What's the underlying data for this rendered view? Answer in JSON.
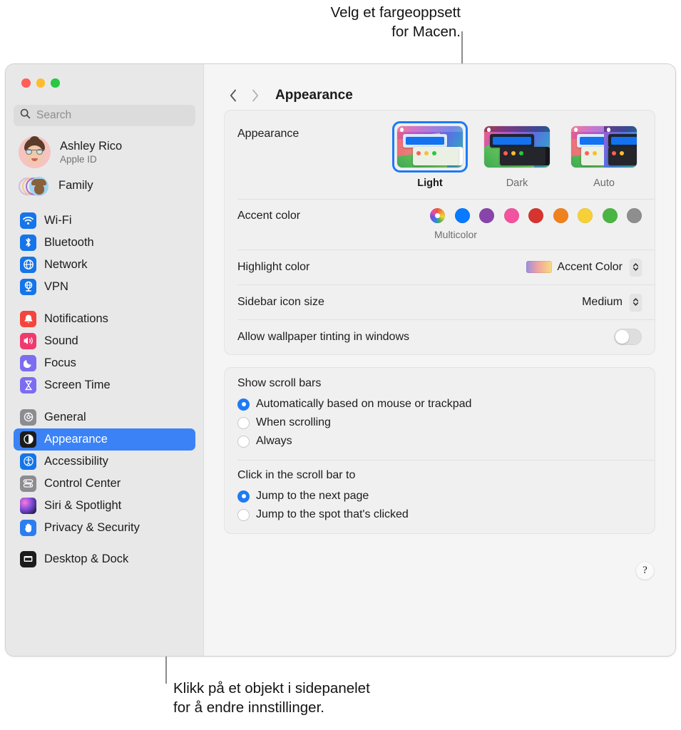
{
  "callouts": {
    "top": "Velg et fargeoppsett\nfor Macen.",
    "bottom": "Klikk på et objekt i sidepanelet\nfor å endre innstillinger."
  },
  "window": {
    "traffic_lights": [
      "close",
      "minimize",
      "zoom"
    ]
  },
  "sidebar": {
    "search": {
      "placeholder": "Search",
      "value": ""
    },
    "account": {
      "name": "Ashley Rico",
      "subtitle": "Apple ID"
    },
    "family": {
      "label": "Family"
    },
    "groups": [
      {
        "items": [
          {
            "label": "Wi-Fi",
            "icon": "wifi-icon"
          },
          {
            "label": "Bluetooth",
            "icon": "bluetooth-icon"
          },
          {
            "label": "Network",
            "icon": "network-icon"
          },
          {
            "label": "VPN",
            "icon": "vpn-icon"
          }
        ]
      },
      {
        "items": [
          {
            "label": "Notifications",
            "icon": "bell-icon"
          },
          {
            "label": "Sound",
            "icon": "speaker-icon"
          },
          {
            "label": "Focus",
            "icon": "moon-icon"
          },
          {
            "label": "Screen Time",
            "icon": "hourglass-icon"
          }
        ]
      },
      {
        "items": [
          {
            "label": "General",
            "icon": "gear-icon"
          },
          {
            "label": "Appearance",
            "icon": "appearance-icon",
            "selected": true
          },
          {
            "label": "Accessibility",
            "icon": "accessibility-icon"
          },
          {
            "label": "Control Center",
            "icon": "control-center-icon"
          },
          {
            "label": "Siri & Spotlight",
            "icon": "siri-icon"
          },
          {
            "label": "Privacy & Security",
            "icon": "hand-icon"
          }
        ]
      },
      {
        "items": [
          {
            "label": "Desktop & Dock",
            "icon": "desktop-icon"
          }
        ]
      }
    ]
  },
  "content": {
    "title": "Appearance",
    "nav": {
      "back": "back-chevron",
      "forward": "forward-chevron"
    },
    "appearance": {
      "label": "Appearance",
      "options": [
        {
          "label": "Light",
          "selected": true
        },
        {
          "label": "Dark",
          "selected": false
        },
        {
          "label": "Auto",
          "selected": false
        }
      ]
    },
    "accent": {
      "label": "Accent color",
      "caption": "Multicolor",
      "colors": [
        {
          "name": "multicolor",
          "hex": "multi"
        },
        {
          "name": "blue",
          "hex": "#077aff"
        },
        {
          "name": "purple",
          "hex": "#8944ab"
        },
        {
          "name": "pink",
          "hex": "#f2529e"
        },
        {
          "name": "red",
          "hex": "#d7342f"
        },
        {
          "name": "orange",
          "hex": "#f0821e"
        },
        {
          "name": "yellow",
          "hex": "#f7cf36"
        },
        {
          "name": "green",
          "hex": "#4bb543"
        },
        {
          "name": "graphite",
          "hex": "#8e8e8e"
        }
      ]
    },
    "highlight": {
      "label": "Highlight color",
      "value": "Accent Color"
    },
    "sidebar_icon_size": {
      "label": "Sidebar icon size",
      "value": "Medium"
    },
    "wallpaper_tinting": {
      "label": "Allow wallpaper tinting in windows",
      "enabled": false
    },
    "scroll_bars": {
      "label": "Show scroll bars",
      "options": [
        {
          "label": "Automatically based on mouse or trackpad",
          "selected": true
        },
        {
          "label": "When scrolling",
          "selected": false
        },
        {
          "label": "Always",
          "selected": false
        }
      ]
    },
    "click_scroll_bar": {
      "label": "Click in the scroll bar to",
      "options": [
        {
          "label": "Jump to the next page",
          "selected": true
        },
        {
          "label": "Jump to the spot that's clicked",
          "selected": false
        }
      ]
    },
    "help": {
      "label": "?"
    }
  }
}
